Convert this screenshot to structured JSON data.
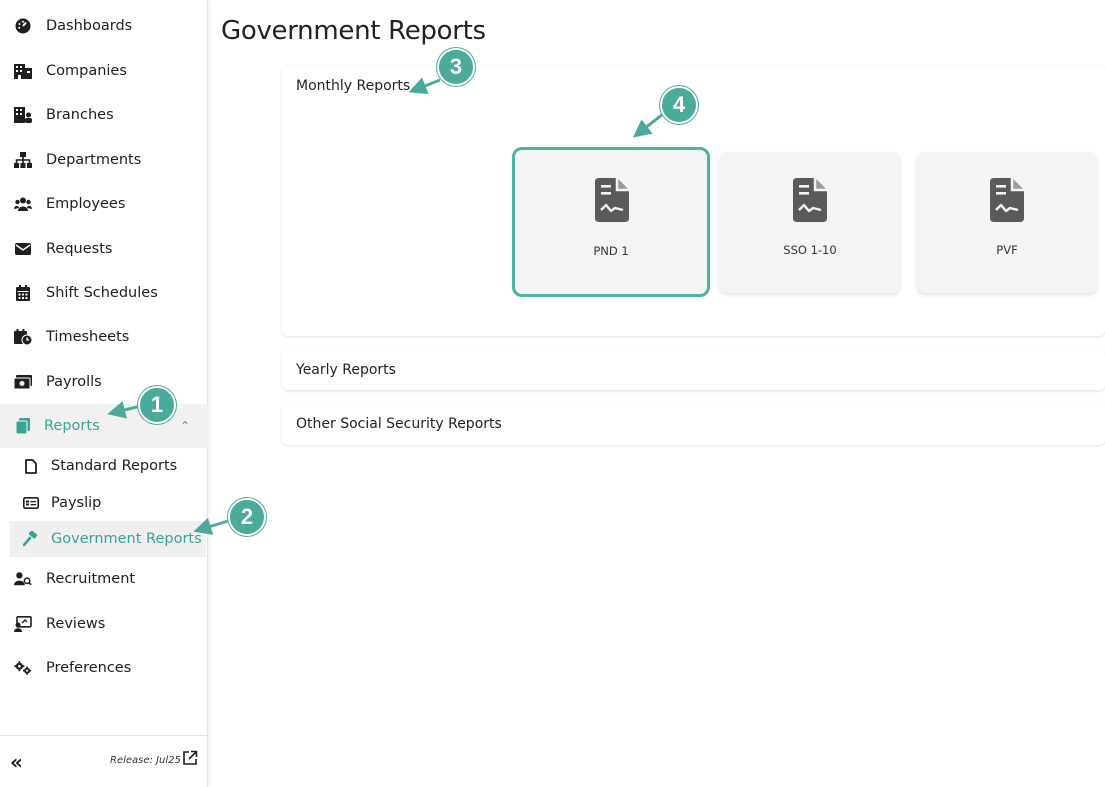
{
  "sidebar": {
    "items": [
      {
        "label": "Dashboards",
        "icon": "dashboard-gauge-icon"
      },
      {
        "label": "Companies",
        "icon": "building-icon"
      },
      {
        "label": "Branches",
        "icon": "branch-building-icon"
      },
      {
        "label": "Departments",
        "icon": "org-chart-icon"
      },
      {
        "label": "Employees",
        "icon": "users-icon"
      },
      {
        "label": "Requests",
        "icon": "envelope-icon"
      },
      {
        "label": "Shift Schedules",
        "icon": "calendar-icon"
      },
      {
        "label": "Timesheets",
        "icon": "calendar-clock-icon"
      },
      {
        "label": "Payrolls",
        "icon": "money-icon"
      },
      {
        "label": "Reports",
        "icon": "copy-docs-icon",
        "active": true
      },
      {
        "label": "Recruitment",
        "icon": "user-search-icon"
      },
      {
        "label": "Reviews",
        "icon": "review-board-icon"
      },
      {
        "label": "Preferences",
        "icon": "gears-icon"
      }
    ],
    "reports_subitems": [
      {
        "label": "Standard Reports",
        "icon": "file-outline-icon"
      },
      {
        "label": "Payslip",
        "icon": "id-card-icon"
      },
      {
        "label": "Government Reports",
        "icon": "gavel-icon",
        "active": true
      }
    ],
    "footer": {
      "collapse_icon": "double-chevron-left-icon",
      "release": "Release: Jul25",
      "external_icon": "external-link-icon"
    }
  },
  "main": {
    "title": "Government Reports",
    "sections": [
      {
        "title": "Monthly Reports",
        "expanded": true,
        "cards": [
          {
            "label": "PND 1",
            "selected": true
          },
          {
            "label": "SSO 1-10"
          },
          {
            "label": "PVF"
          }
        ]
      },
      {
        "title": "Yearly Reports",
        "expanded": false
      },
      {
        "title": "Other Social Security Reports",
        "expanded": false
      }
    ]
  },
  "annotations": [
    "1",
    "2",
    "3",
    "4"
  ],
  "colors": {
    "accent": "#3aa393",
    "badge": "#4bab9a",
    "icon_dark": "#5a5a5a"
  }
}
